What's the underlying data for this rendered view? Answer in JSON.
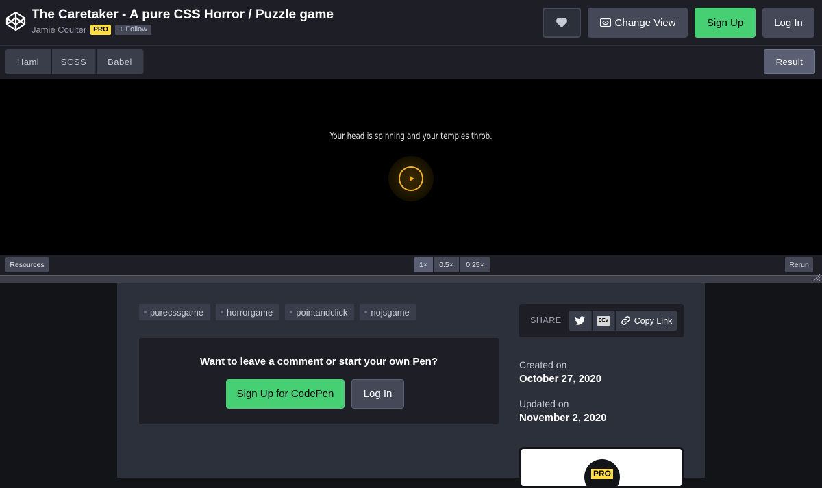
{
  "header": {
    "title": "The Caretaker - A pure CSS Horror / Puzzle game",
    "author": "Jamie Coulter",
    "pro_badge": "PRO",
    "follow_label": "Follow",
    "change_view_label": "Change View",
    "sign_up_label": "Sign Up",
    "log_in_label": "Log In"
  },
  "editor_tabs": [
    "Haml",
    "SCSS",
    "Babel"
  ],
  "result_tab": "Result",
  "preview": {
    "text": "Your head is spinning and your temples throb."
  },
  "footer": {
    "resources_label": "Resources",
    "zoom_options": [
      "1×",
      "0.5×",
      "0.25×"
    ],
    "zoom_selected": "1×",
    "rerun_label": "Rerun"
  },
  "details": {
    "tags": [
      "purecssgame",
      "horrorgame",
      "pointandclick",
      "nojsgame"
    ],
    "comment_prompt": "Want to leave a comment or start your own Pen?",
    "comment_signup_label": "Sign Up for CodePen",
    "comment_login_label": "Log In",
    "share_label": "SHARE",
    "copy_link_label": "Copy Link",
    "dev_label": "DEV",
    "created_label": "Created on",
    "created_value": "October 27, 2020",
    "updated_label": "Updated on",
    "updated_value": "November 2, 2020",
    "promo_badge": "PRO"
  },
  "colors": {
    "accent_green": "#47cf73",
    "pro_yellow": "#ffdd40",
    "play_gold": "#f2b320"
  },
  "icons": [
    "codepen-logo-icon",
    "heart-icon",
    "eye-icon",
    "plus-icon",
    "play-icon",
    "twitter-icon",
    "dev-icon",
    "link-icon",
    "resize-handle-icon"
  ]
}
